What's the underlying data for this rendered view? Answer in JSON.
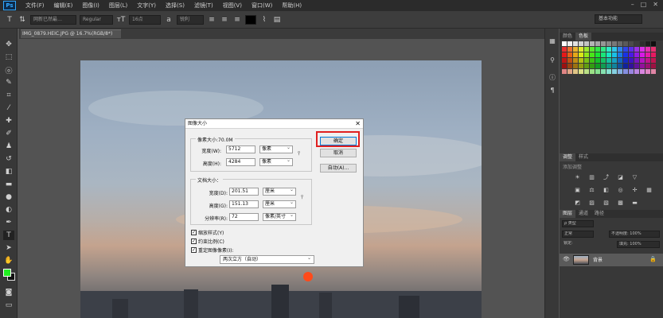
{
  "app": {
    "logo": "Ps"
  },
  "menu": [
    "文件(F)",
    "编辑(E)",
    "图像(I)",
    "图层(L)",
    "文字(Y)",
    "选择(S)",
    "滤镜(T)",
    "视图(V)",
    "窗口(W)",
    "帮助(H)"
  ],
  "options_bar": {
    "tool_glyph": "T",
    "font_family": "网新已然最…",
    "font_style": "Regular",
    "font_size": "16点",
    "antialias": "锐利",
    "workspace": "基本功能"
  },
  "document_tab": {
    "label": "IMG_0879.HEIC.JPG @ 16.7%(RGB/8*)"
  },
  "dialog": {
    "title": "图像大小",
    "pixel_group": {
      "title": "像素大小:70.0M",
      "width_label": "宽度(W):",
      "width_value": "5712",
      "width_unit": "像素",
      "height_label": "高度(H):",
      "height_value": "4284",
      "height_unit": "像素"
    },
    "doc_group": {
      "title": "文档大小：",
      "width_label": "宽度(D):",
      "width_value": "201.51",
      "width_unit": "厘米",
      "height_label": "高度(G):",
      "height_value": "151.13",
      "height_unit": "厘米",
      "res_label": "分辨率(R):",
      "res_value": "72",
      "res_unit": "像素/英寸"
    },
    "checks": {
      "scale_styles": "缩放样式(Y)",
      "constrain": "约束比例(C)",
      "resample": "重定图像像素(I):"
    },
    "resample_method": "两次立方（自动）",
    "buttons": {
      "ok": "确定",
      "cancel": "取消",
      "auto": "自动(A)..."
    }
  },
  "panels": {
    "color_tabs": [
      "颜色",
      "色板"
    ],
    "adjust_tabs": [
      "调整",
      "样式"
    ],
    "adjust_hint": "添加调整",
    "layer_tabs": [
      "图层",
      "通道",
      "路径"
    ],
    "layer_kind": "ρ 类型",
    "blend_mode": "正常",
    "opacity": "不透明度: 100%",
    "lock": "锁定:",
    "fill": "填充: 100%",
    "layer_name": "背景"
  },
  "colors": {
    "foreground": "#22ee22",
    "background": "#111111",
    "ok_highlight": "#e02020"
  }
}
